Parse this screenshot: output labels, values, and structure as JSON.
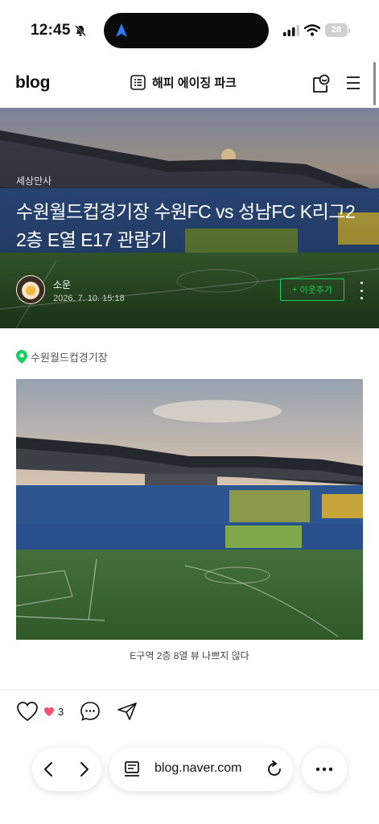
{
  "status_bar": {
    "time": "12:45",
    "battery": "28",
    "icons": [
      "bell-slash-icon",
      "location-arrow-icon",
      "cellular-signal-icon",
      "wifi-icon",
      "battery-icon"
    ]
  },
  "header": {
    "logo": "blog",
    "blog_name": "해피 에이징 파크",
    "icons": [
      "list-icon",
      "store-icon",
      "menu-icon"
    ]
  },
  "post": {
    "category": "세상만사",
    "title": "수원월드컵경기장 수원FC vs 성남FC K리그2 2층 E열 E17 관람기",
    "author": "소운",
    "date": "2026. 7. 10. 15:18",
    "follow_label": "이웃추가",
    "location": "수원월드컵경기장",
    "photo_caption": "E구역 2층 8열 뷰 나쁘지 않다"
  },
  "actions": {
    "like_count": "3",
    "icons": [
      "heart-outline-icon",
      "heart-filled-icon",
      "comment-icon",
      "share-icon"
    ]
  },
  "browser": {
    "url": "blog.naver.com",
    "icons": [
      "back-icon",
      "forward-icon",
      "page-icon",
      "reload-icon",
      "more-horizontal-icon"
    ]
  },
  "colors": {
    "naver_green": "#19ce60",
    "like_pink": "#ff4f6e",
    "text_dark": "#111111"
  }
}
